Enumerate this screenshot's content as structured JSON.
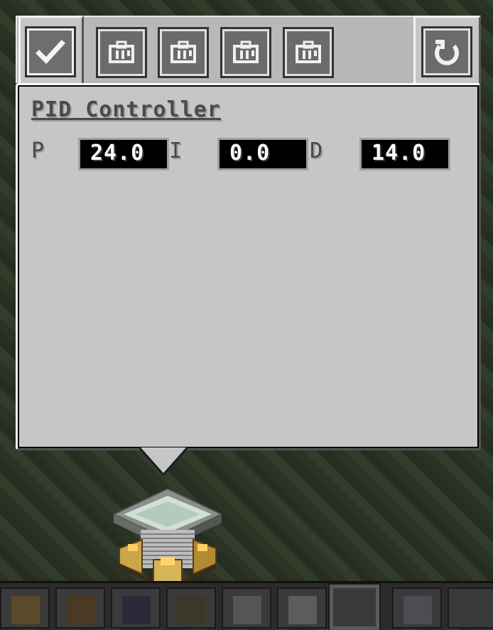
{
  "window": {
    "title": "PID Controller"
  },
  "toolbar": {
    "confirm_icon": "checkmark-icon",
    "module_tabs": [
      {
        "icon": "module-icon"
      },
      {
        "icon": "module-icon"
      },
      {
        "icon": "module-icon"
      },
      {
        "icon": "module-icon"
      }
    ],
    "reset_icon": "refresh-icon"
  },
  "pid": {
    "p_label": "P",
    "p_value": "24.0",
    "i_label": "I",
    "i_value": "0.0",
    "d_label": "D",
    "d_value": "14.0"
  },
  "colors": {
    "panel": "#c6c6c6",
    "field": "#000000",
    "text": "#4a4a4a"
  }
}
